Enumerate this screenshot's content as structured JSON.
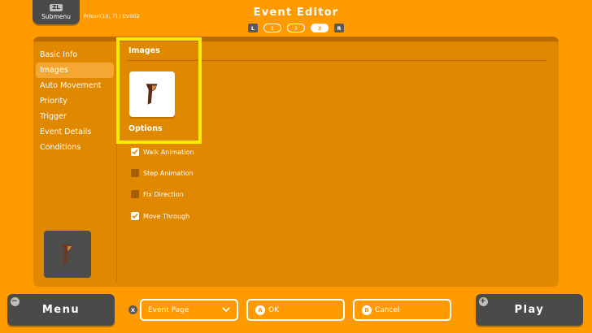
{
  "header": {
    "submenu_key": "ZL",
    "submenu_label": "Submenu",
    "breadcrumb": "Prison(10, 7) / EV002",
    "title": "Event Editor",
    "left_key": "L",
    "right_key": "R",
    "pages": [
      "1",
      "2",
      "3"
    ],
    "active_page": "3"
  },
  "sidebar": {
    "items": [
      {
        "label": "Basic Info"
      },
      {
        "label": "Images"
      },
      {
        "label": "Auto Movement"
      },
      {
        "label": "Priority"
      },
      {
        "label": "Trigger"
      },
      {
        "label": "Event Details"
      },
      {
        "label": "Conditions"
      }
    ],
    "active_item": "Images"
  },
  "content": {
    "images_title": "Images",
    "options_title": "Options",
    "options": [
      {
        "label": "Walk Animation",
        "checked": true
      },
      {
        "label": "Step Animation",
        "checked": false
      },
      {
        "label": "Fix Direction",
        "checked": false
      },
      {
        "label": "Move Through",
        "checked": true
      }
    ]
  },
  "footer": {
    "menu_key": "−",
    "menu_label": "Menu",
    "page_key": "X",
    "page_select": "Event Page",
    "ok_key": "A",
    "ok_label": "OK",
    "cancel_key": "B",
    "cancel_label": "Cancel",
    "play_key": "+",
    "play_label": "Play"
  },
  "colors": {
    "background": "#ff9a00",
    "panel": "#e08800",
    "button_dark": "#4a4a4a",
    "highlight": "#ffeb00"
  }
}
